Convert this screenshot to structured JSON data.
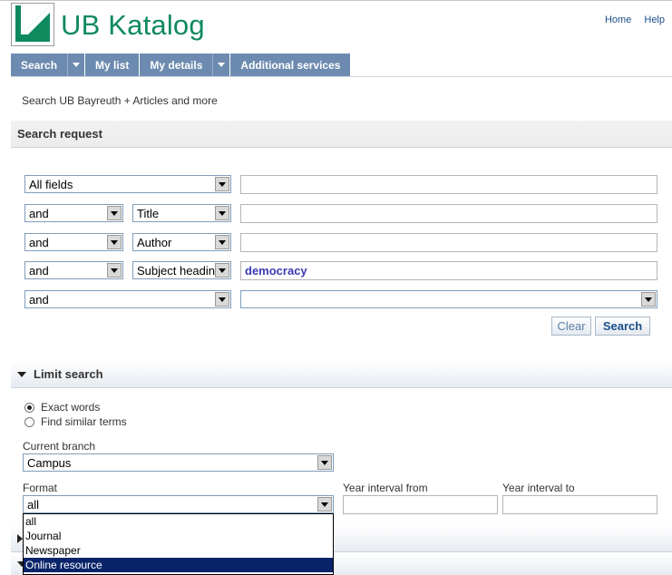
{
  "header": {
    "app_title": "UB Katalog",
    "links": {
      "home": "Home",
      "help": "Help"
    }
  },
  "nav": {
    "search": "Search",
    "my_list": "My list",
    "my_details": "My details",
    "additional_services": "Additional services"
  },
  "search_scope": "Search UB Bayreuth + Articles and more",
  "search_request": {
    "heading": "Search request",
    "rows": [
      {
        "operator": "",
        "field": "All fields",
        "value": ""
      },
      {
        "operator": "and",
        "field": "Title",
        "value": ""
      },
      {
        "operator": "and",
        "field": "Author",
        "value": ""
      },
      {
        "operator": "and",
        "field": "Subject heading",
        "value": "democracy"
      },
      {
        "operator": "and",
        "field": "",
        "value": ""
      }
    ],
    "clear_label": "Clear",
    "search_label": "Search"
  },
  "limit_search": {
    "heading": "Limit search",
    "match_options": [
      "Exact words",
      "Find similar terms"
    ],
    "selected_match": "Exact words",
    "branch_label": "Current branch",
    "branch_value": "Campus",
    "format_label": "Format",
    "format_value": "all",
    "format_options": [
      "all",
      "Journal",
      "Newspaper",
      "Online resource"
    ],
    "format_highlighted": "Online resource",
    "year_from_label": "Year interval from",
    "year_to_label": "Year interval  to"
  },
  "colors": {
    "brand_green": "#0f8a5f",
    "nav_blue": "#6d8bb0",
    "link_blue": "#1b4f8a",
    "highlight": "#0a246a"
  }
}
